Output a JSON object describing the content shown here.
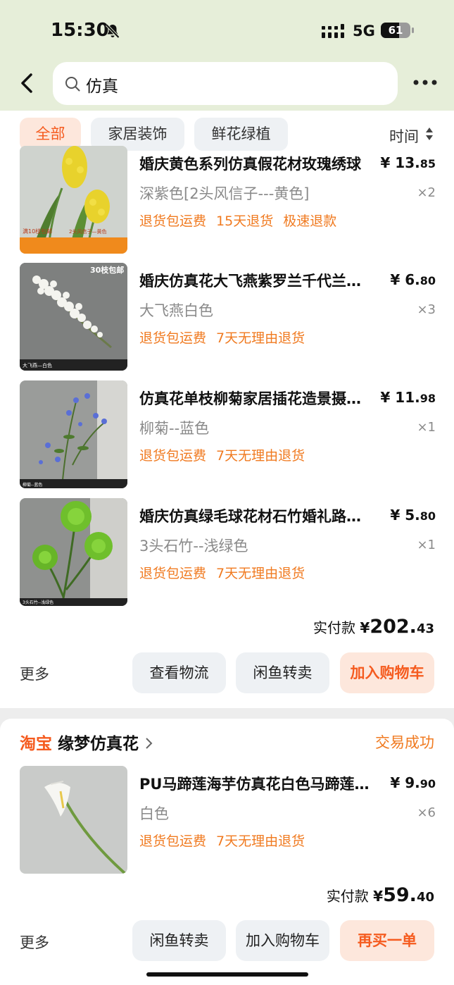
{
  "status_bar": {
    "time": "15:30",
    "network": "5G",
    "battery": "61",
    "battery_level": 0.61
  },
  "search": {
    "query": "仿真"
  },
  "filters": {
    "chips": [
      "全部",
      "家居装饰",
      "鲜花绿植"
    ],
    "sort_label": "时间"
  },
  "order1": {
    "items": [
      {
        "title": "婚庆黄色系列仿真假花材玫瑰绣球",
        "price_int": "¥ 13.",
        "price_cents": "85",
        "variant": "深紫色[2头风信子---黄色]",
        "qty": "×2",
        "tags": [
          "退货包运费",
          "15天退货",
          "极速退款"
        ],
        "thumb_caption": "满10枝包邮",
        "thumb_label": "2头风信子—黄色"
      },
      {
        "title": "婚庆仿真花大飞燕紫罗兰千代兰…",
        "price_int": "¥ 6.",
        "price_cents": "80",
        "variant": "大飞燕白色",
        "qty": "×3",
        "tags": [
          "退货包运费",
          "7天无理由退货"
        ],
        "thumb_caption": "30枝包邮",
        "thumb_label": "大飞燕—白色"
      },
      {
        "title": "仿真花单枝柳菊家居插花造景摄…",
        "price_int": "¥ 11.",
        "price_cents": "98",
        "variant": "柳菊--蓝色",
        "qty": "×1",
        "tags": [
          "退货包运费",
          "7天无理由退货"
        ],
        "thumb_caption": "",
        "thumb_label": "柳菊--蓝色"
      },
      {
        "title": "婚庆仿真绿毛球花材石竹婚礼路…",
        "price_int": "¥ 5.",
        "price_cents": "80",
        "variant": "3头石竹--浅绿色",
        "qty": "×1",
        "tags": [
          "退货包运费",
          "7天无理由退货"
        ],
        "thumb_caption": "",
        "thumb_label": "3头石竹--浅绿色"
      }
    ],
    "total_label": "实付款",
    "total_yen": "¥",
    "total_int": "202.",
    "total_cents": "43",
    "more_label": "更多",
    "buttons": [
      "查看物流",
      "闲鱼转卖",
      "加入购物车"
    ]
  },
  "order2": {
    "brand": "淘宝",
    "shop_name": "缘梦仿真花",
    "status": "交易成功",
    "items": [
      {
        "title": "PU马蹄莲海芋仿真花白色马蹄莲…",
        "price_int": "¥ 9.",
        "price_cents": "90",
        "variant": "白色",
        "qty": "×6",
        "tags": [
          "退货包运费",
          "7天无理由退货"
        ]
      }
    ],
    "total_label": "实付款",
    "total_yen": "¥",
    "total_int": "59.",
    "total_cents": "40",
    "more_label": "更多",
    "buttons": [
      "闲鱼转卖",
      "加入购物车",
      "再买一单"
    ]
  },
  "colors": {
    "header_bg": "#e6eed9",
    "accent_orange": "#f55b1f",
    "tag_orange": "#f07a20"
  }
}
